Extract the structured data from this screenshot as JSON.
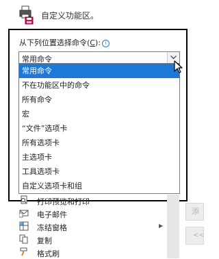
{
  "header": {
    "title": "自定义功能区。"
  },
  "chooser": {
    "label_prefix": "从下列位置选择命令(",
    "label_key": "C",
    "label_suffix": "):",
    "info_glyph": "i",
    "selected_value": "常用命令"
  },
  "dropdown": {
    "options": [
      "常用命令",
      "不在功能区中的命令",
      "所有命令",
      "宏",
      "“文件”选项卡",
      "所有选项卡",
      "主选项卡",
      "工具选项卡",
      "自定义选项卡和组"
    ],
    "selected_index": 0
  },
  "commands": [
    {
      "label": "打印预览和打印",
      "icon": "print-preview-icon"
    },
    {
      "label": "电子邮件",
      "icon": "email-icon"
    },
    {
      "label": "冻结窗格",
      "icon": "freeze-panes-icon",
      "has_submenu": true
    },
    {
      "label": "复制",
      "icon": "copy-icon"
    },
    {
      "label": "格式刷",
      "icon": "format-painter-icon"
    }
  ],
  "side_buttons": {
    "add_label": "添加",
    "remove_label": "<<"
  },
  "colors": {
    "selection": "#1e78d7",
    "frame": "#000000",
    "info": "#2b78c5"
  }
}
